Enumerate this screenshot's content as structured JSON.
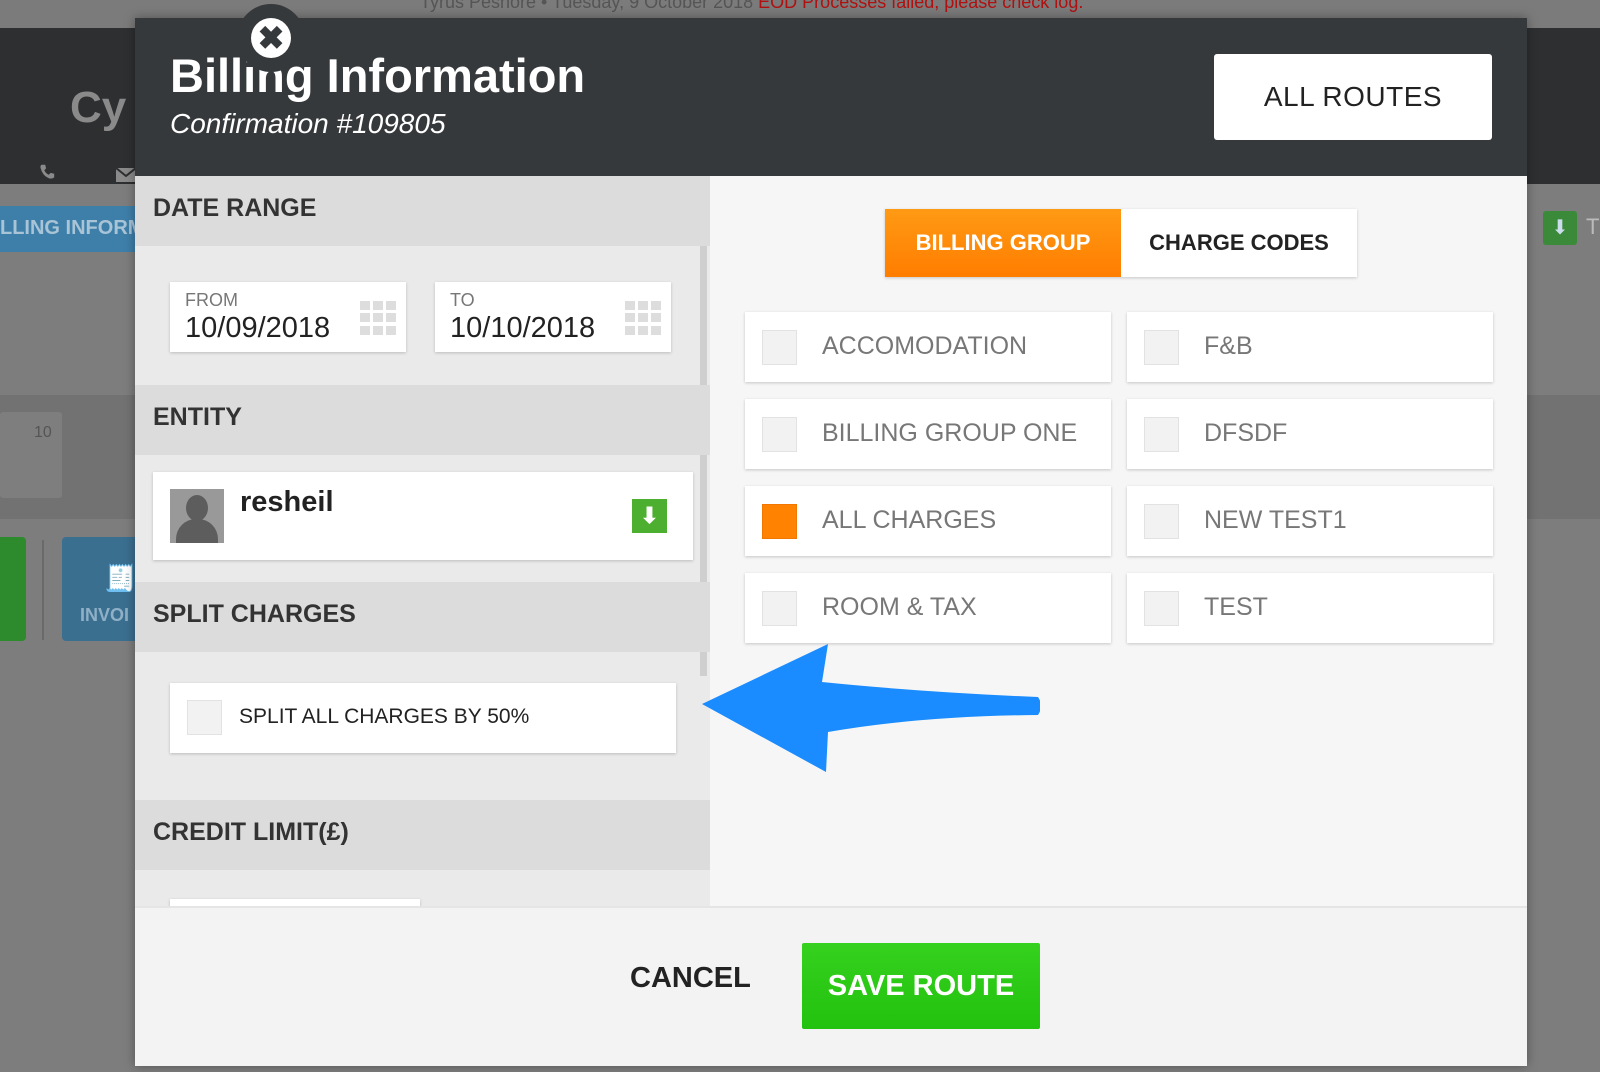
{
  "background": {
    "top_message": "Tyrus Peshore • Tuesday, 9 October 2018",
    "top_error": "EOD Processes failed, please check log.",
    "app_title": "Cy",
    "tab_label": "LLING INFORM",
    "calendar_number": "10",
    "invoice_label": "INVOI",
    "right_letter": "T"
  },
  "modal": {
    "title": "Billing Information",
    "subtitle": "Confirmation #109805",
    "all_routes_label": "ALL ROUTES",
    "close_symbol": "✖"
  },
  "left": {
    "date_range": {
      "heading": "DATE RANGE",
      "from_label": "FROM",
      "from_value": "10/09/2018",
      "to_label": "TO",
      "to_value": "10/10/2018"
    },
    "entity": {
      "heading": "ENTITY",
      "name": "resheil",
      "dropdown_symbol": "⬇"
    },
    "split": {
      "heading": "SPLIT CHARGES",
      "label": "SPLIT ALL CHARGES BY 50%",
      "checked": false
    },
    "credit": {
      "heading": "CREDIT LIMIT(£)"
    }
  },
  "right": {
    "tabs": {
      "billing_group": "BILLING GROUP",
      "charge_codes": "CHARGE CODES",
      "active": "billing_group"
    },
    "groups": [
      {
        "label": "ACCOMODATION",
        "checked": false
      },
      {
        "label": "F&B",
        "checked": false
      },
      {
        "label": "BILLING GROUP ONE",
        "checked": false
      },
      {
        "label": "DFSDF",
        "checked": false
      },
      {
        "label": "ALL CHARGES",
        "checked": true
      },
      {
        "label": "NEW TEST1",
        "checked": false
      },
      {
        "label": "ROOM & TAX",
        "checked": false
      },
      {
        "label": "TEST",
        "checked": false
      }
    ]
  },
  "footer": {
    "cancel_label": "CANCEL",
    "save_label": "SAVE ROUTE"
  },
  "colors": {
    "accent_orange": "#ff8200",
    "save_green": "#2ac914",
    "annotation_arrow": "#1a8cff",
    "header_dark": "#36393b"
  }
}
